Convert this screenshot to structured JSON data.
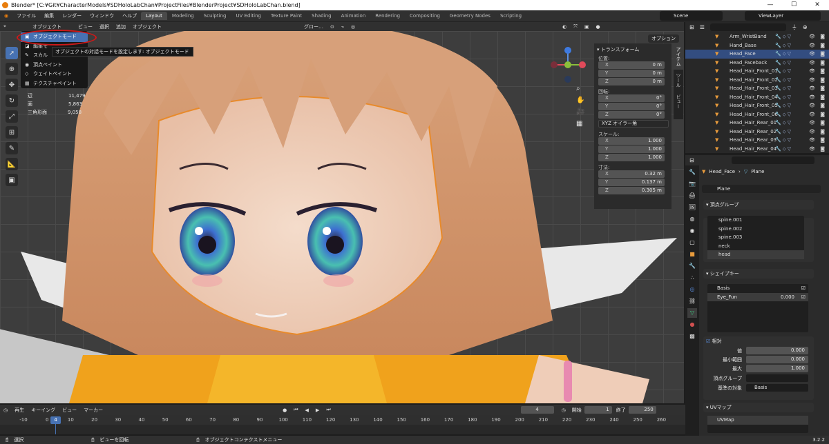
{
  "window": {
    "title": "Blender* [C:¥Git¥CharacterModels¥SDHoloLabChan¥ProjectFiles¥BlenderProject¥SDHoloLabChan.blend]",
    "minimize": "—",
    "maximize": "☐",
    "close": "✕"
  },
  "topbar": {
    "menus": [
      "ファイル",
      "編集",
      "レンダー",
      "ウィンドウ",
      "ヘルプ"
    ],
    "workspaces": [
      "Layout",
      "Modeling",
      "Sculpting",
      "UV Editing",
      "Texture Paint",
      "Shading",
      "Animation",
      "Rendering",
      "Compositing",
      "Geometry Nodes",
      "Scripting"
    ],
    "active_workspace": "Layout",
    "scene": "Scene",
    "view_layer": "ViewLayer"
  },
  "viewport_header": {
    "mode": "オブジェクト",
    "menus": [
      "ビュー",
      "選択",
      "追加",
      "オブジェクト"
    ],
    "transform_orientation": "グロー…",
    "options_button": "オプション"
  },
  "mode_dropdown": {
    "items": [
      {
        "icon": "▣",
        "label": "オブジェクトモード"
      },
      {
        "icon": "◪",
        "label": "編集モ"
      },
      {
        "icon": "✎",
        "label": "スカル"
      },
      {
        "icon": "◉",
        "label": "頂点ペイント"
      },
      {
        "icon": "◇",
        "label": "ウェイトペイント"
      },
      {
        "icon": "▦",
        "label": "テクスチャペイント"
      }
    ],
    "tooltip": "オブジェクトの対話モードを設定します: オブジェクトモード"
  },
  "stats": [
    {
      "label": "辺",
      "value": "11,479"
    },
    {
      "label": "面",
      "value": "5,863"
    },
    {
      "label": "三角形面",
      "value": "9,058"
    }
  ],
  "npanel": {
    "section": "トランスフォーム",
    "location_label": "位置:",
    "location": [
      {
        "axis": "X",
        "value": "0 m"
      },
      {
        "axis": "Y",
        "value": "0 m"
      },
      {
        "axis": "Z",
        "value": "0 m"
      }
    ],
    "rotation_label": "回転:",
    "rotation": [
      {
        "axis": "X",
        "value": "0°"
      },
      {
        "axis": "Y",
        "value": "0°"
      },
      {
        "axis": "Z",
        "value": "0°"
      }
    ],
    "rotation_mode": "XYZ オイラー角",
    "scale_label": "スケール:",
    "scale": [
      {
        "axis": "X",
        "value": "1.000"
      },
      {
        "axis": "Y",
        "value": "1.000"
      },
      {
        "axis": "Z",
        "value": "1.000"
      }
    ],
    "dimensions_label": "寸法:",
    "dimensions": [
      {
        "axis": "X",
        "value": "0.32 m"
      },
      {
        "axis": "Y",
        "value": "0.137 m"
      },
      {
        "axis": "Z",
        "value": "0.305 m"
      }
    ],
    "tabs": [
      "アイテム",
      "ツール",
      "ビュー"
    ]
  },
  "outliner": {
    "rows": [
      "Arm_WristBand",
      "Hand_Base",
      "Head_Face",
      "Head_Faceback",
      "Head_Hair_Front_01",
      "Head_Hair_Front_02",
      "Head_Hair_Front_03",
      "Head_Hair_Front_04",
      "Head_Hair_Front_05",
      "Head_Hair_Front_06",
      "Head_Hair_Rear_01",
      "Head_Hair_Rear_02",
      "Head_Hair_Rear_03",
      "Head_Hair_Rear_04"
    ],
    "selected": "Head_Face"
  },
  "properties": {
    "breadcrumb_object": "Head_Face",
    "breadcrumb_mesh": "Plane",
    "mesh_name": "Plane",
    "vertex_groups_title": "頂点グループ",
    "vertex_groups": [
      "spine.001",
      "spine.002",
      "spine.003",
      "neck",
      "head"
    ],
    "active_vertex_group": "head",
    "shape_keys_title": "シェイプキー",
    "shape_keys": [
      {
        "name": "Basis",
        "value": ""
      },
      {
        "name": "Eye_Fun",
        "value": "0.000"
      }
    ],
    "relative_label": "相対",
    "value_label": "値",
    "value": "0.000",
    "range_min_label": "最小範囲",
    "range_min": "0.000",
    "range_max_label": "最大",
    "range_max": "1.000",
    "vgroup_label": "頂点グループ",
    "relative_to_label": "基準の対象",
    "relative_to": "Basis",
    "uv_title": "UVマップ",
    "uv_map": "UVMap"
  },
  "timeline": {
    "menus": [
      "再生",
      "キーイング",
      "ビュー",
      "マーカー"
    ],
    "current_frame": "4",
    "start_label": "開始",
    "start": "1",
    "end_label": "終了",
    "end": "250",
    "ticks": [
      "-10",
      "0",
      "10",
      "20",
      "30",
      "40",
      "50",
      "60",
      "70",
      "80",
      "90",
      "100",
      "110",
      "120",
      "130",
      "140",
      "150",
      "160",
      "170",
      "180",
      "190",
      "200",
      "210",
      "220",
      "230",
      "240",
      "250",
      "260"
    ]
  },
  "statusbar": {
    "select": "選択",
    "rotate": "ビューを回転",
    "context": "オブジェクトコンテクストメニュー",
    "version": "3.2.2"
  }
}
